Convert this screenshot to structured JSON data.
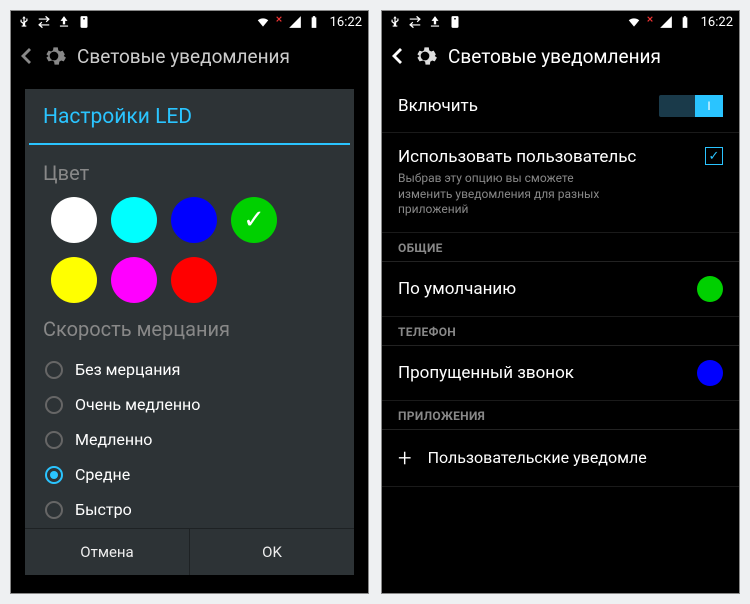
{
  "status": {
    "time": "16:22"
  },
  "header": {
    "title": "Световые уведомления"
  },
  "dialog": {
    "title": "Настройки LED",
    "color_label": "Цвет",
    "colors": [
      {
        "name": "white",
        "value": "#ffffff",
        "selected": false
      },
      {
        "name": "cyan",
        "value": "#00ffff",
        "selected": false
      },
      {
        "name": "blue",
        "value": "#0000ff",
        "selected": false
      },
      {
        "name": "green",
        "value": "#00d000",
        "selected": true
      },
      {
        "name": "yellow",
        "value": "#ffff00",
        "selected": false
      },
      {
        "name": "magenta",
        "value": "#ff00ff",
        "selected": false
      },
      {
        "name": "red",
        "value": "#ff0000",
        "selected": false
      }
    ],
    "speed_label": "Скорость мерцания",
    "speed_options": [
      {
        "label": "Без мерцания",
        "selected": false
      },
      {
        "label": "Очень медленно",
        "selected": false
      },
      {
        "label": "Медленно",
        "selected": false
      },
      {
        "label": "Средне",
        "selected": true
      },
      {
        "label": "Быстро",
        "selected": false
      }
    ],
    "cancel": "Отмена",
    "ok": "OK"
  },
  "settings": {
    "enable": {
      "label": "Включить",
      "on": true
    },
    "custom": {
      "title": "Использовать пользовательс",
      "sub": "Выбрав эту опцию вы сможете изменить уведомления для разных приложений",
      "checked": true
    },
    "sections": {
      "general": {
        "header": "ОБЩИЕ",
        "item_label": "По умолчанию",
        "color": "#00d000"
      },
      "phone": {
        "header": "ТЕЛЕФОН",
        "item_label": "Пропущенный звонок",
        "color": "#0000ff"
      },
      "apps": {
        "header": "ПРИЛОЖЕНИЯ",
        "add_label": "Пользовательские уведомле"
      }
    }
  }
}
